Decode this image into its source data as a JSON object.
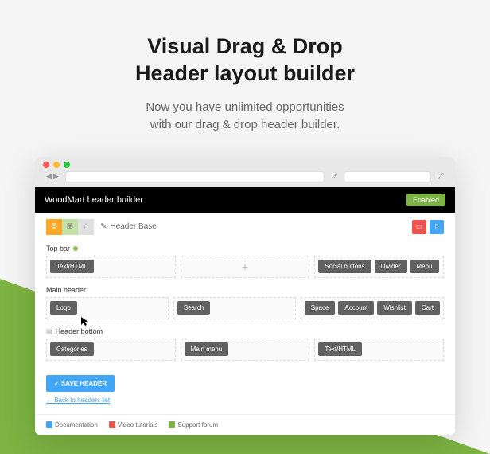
{
  "page": {
    "title_line1": "Visual Drag & Drop",
    "title_line2": "Header layout builder",
    "subtitle_line1": "Now you have unlimited opportunities",
    "subtitle_line2": "with our drag & drop header builder."
  },
  "app": {
    "title": "WoodMart header builder",
    "enabled_label": "Enabled",
    "header_base": "Header Base",
    "save_button": "SAVE HEADER",
    "back_link": "← Back to headers list"
  },
  "sections": {
    "top_bar": {
      "label": "Top bar",
      "left": [
        "Text/HTML"
      ],
      "center_plus": "+",
      "right": [
        "Social buttons",
        "Divider",
        "Menu"
      ]
    },
    "main_header": {
      "label": "Main header",
      "left": [
        "Logo"
      ],
      "center": [
        "Search"
      ],
      "right": [
        "Space",
        "Account",
        "Wishlist",
        "Cart"
      ]
    },
    "header_bottom": {
      "label": "Header bottom",
      "left": [
        "Categories"
      ],
      "center": [
        "Main menu"
      ],
      "right": [
        "Text/HTML"
      ]
    }
  },
  "footer": {
    "docs": "Documentation",
    "videos": "Video tutorials",
    "forum": "Support forum"
  },
  "icons": {
    "gear": "⚙",
    "star": "☆",
    "pencil": "✎",
    "check": "✓",
    "desktop": "▭",
    "mobile": "▯"
  }
}
